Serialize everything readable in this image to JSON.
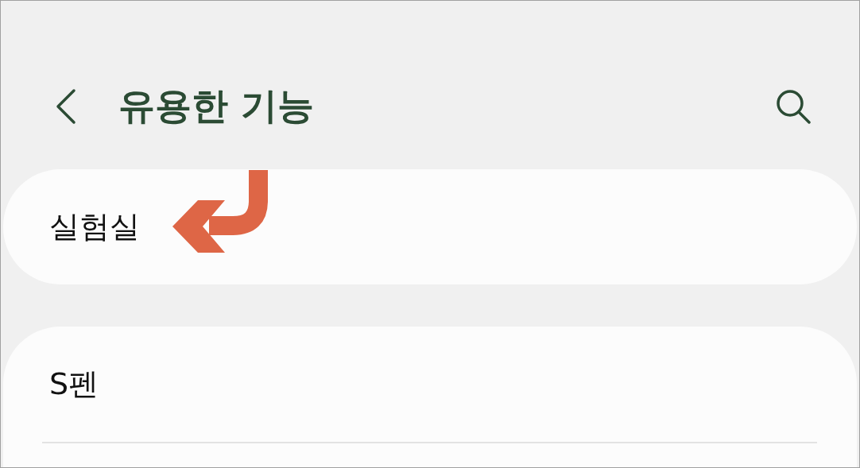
{
  "header": {
    "title": "유용한 기능"
  },
  "groups": [
    {
      "continues": false,
      "items": [
        {
          "label": "실험실"
        }
      ]
    },
    {
      "continues": true,
      "items": [
        {
          "label": "S펜"
        }
      ]
    }
  ]
}
